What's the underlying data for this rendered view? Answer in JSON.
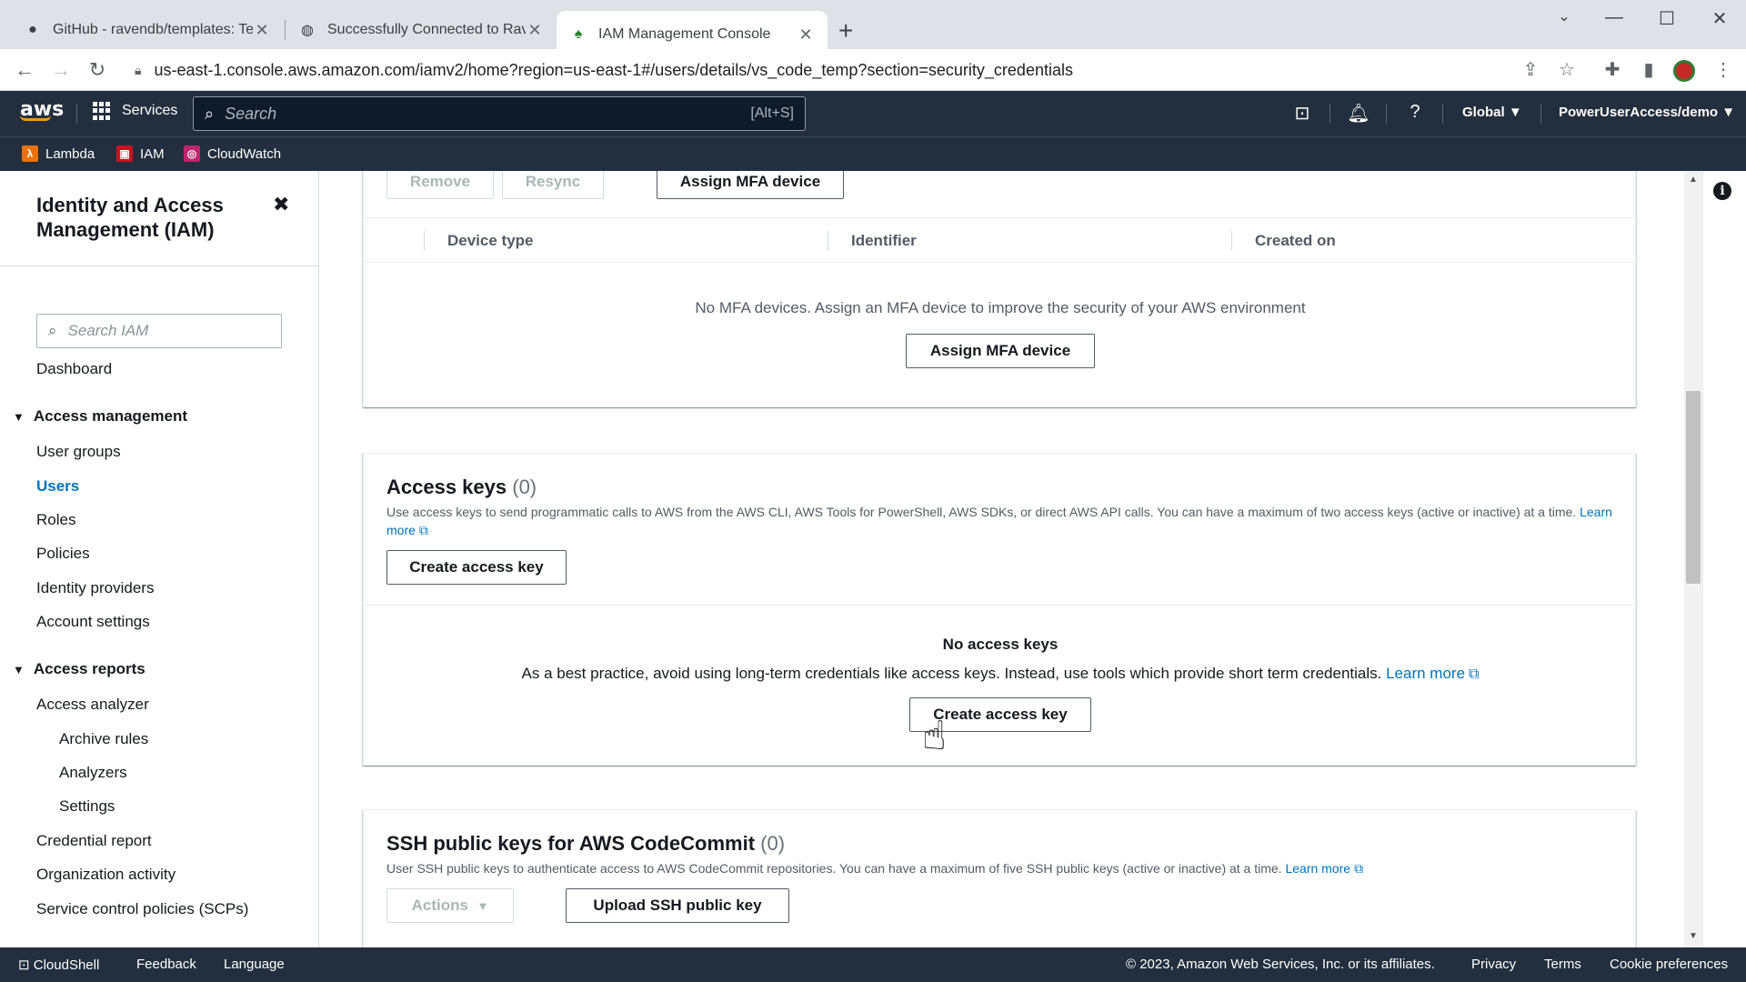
{
  "browser": {
    "tabs": [
      {
        "title": "GitHub - ravendb/templates: Ten",
        "icon": "github-icon"
      },
      {
        "title": "Successfully Connected to Raven",
        "icon": "globe-icon"
      },
      {
        "title": "IAM Management Console",
        "icon": "aws-leaf-icon"
      }
    ],
    "url": "us-east-1.console.aws.amazon.com/iamv2/home?region=us-east-1#/users/details/vs_code_temp?section=security_credentials"
  },
  "aws_header": {
    "logo": "aws",
    "services_label": "Services",
    "search_placeholder": "Search",
    "search_hint": "[Alt+S]",
    "region": "Global",
    "account": "PowerUserAccess/demo",
    "favorites": [
      "Lambda",
      "IAM",
      "CloudWatch"
    ]
  },
  "sidebar": {
    "title": "Identity and Access Management (IAM)",
    "search_placeholder": "Search IAM",
    "dashboard": "Dashboard",
    "access_management": {
      "label": "Access management",
      "items": [
        "User groups",
        "Users",
        "Roles",
        "Policies",
        "Identity providers",
        "Account settings"
      ]
    },
    "access_reports": {
      "label": "Access reports",
      "items": [
        "Access analyzer",
        "Archive rules",
        "Analyzers",
        "Settings",
        "Credential report",
        "Organization activity",
        "Service control policies (SCPs)"
      ]
    }
  },
  "mfa": {
    "remove": "Remove",
    "resync": "Resync",
    "assign": "Assign MFA device",
    "columns": [
      "Device type",
      "Identifier",
      "Created on"
    ],
    "empty_text": "No MFA devices. Assign an MFA device to improve the security of your AWS environment",
    "empty_button": "Assign MFA device"
  },
  "access_keys": {
    "title": "Access keys",
    "count": "(0)",
    "description": "Use access keys to send programmatic calls to AWS from the AWS CLI, AWS Tools for PowerShell, AWS SDKs, or direct AWS API calls. You can have a maximum of two access keys (active or inactive) at a time.",
    "learn_more": "Learn more",
    "create_button": "Create access key",
    "empty_title": "No access keys",
    "empty_text": "As a best practice, avoid using long-term credentials like access keys. Instead, use tools which provide short term credentials.",
    "empty_learn_more": "Learn more",
    "empty_button": "Create access key"
  },
  "ssh_keys": {
    "title": "SSH public keys for AWS CodeCommit",
    "count": "(0)",
    "description": "User SSH public keys to authenticate access to AWS CodeCommit repositories. You can have a maximum of five SSH public keys (active or inactive) at a time.",
    "learn_more": "Learn more",
    "actions": "Actions",
    "upload": "Upload SSH public key"
  },
  "footer": {
    "cloudshell": "CloudShell",
    "feedback": "Feedback",
    "language": "Language",
    "copyright": "© 2023, Amazon Web Services, Inc. or its affiliates.",
    "privacy": "Privacy",
    "terms": "Terms",
    "cookies": "Cookie preferences"
  }
}
